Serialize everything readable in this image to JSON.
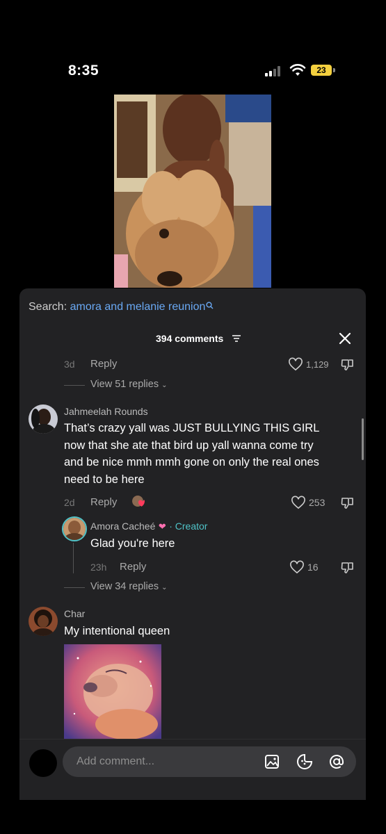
{
  "status_bar": {
    "time": "8:35",
    "battery": "23"
  },
  "sheet": {
    "search_label": "Search: ",
    "search_term": "amora and melanie reunion",
    "comments_count": "394 comments"
  },
  "top_thread": {
    "age": "3d",
    "reply_label": "Reply",
    "likes": "1,129",
    "view_replies": "View 51 replies"
  },
  "comments": [
    {
      "username": "Jahmeelah Rounds",
      "text_lines": [
        "That’s crazy yall was JUST BULLYING THIS GIRL",
        "now that she ate that bird up yall wanna come try",
        "and be nice mmh mmh gone on only the real ones",
        "need to be here"
      ],
      "age": "2d",
      "reply_label": "Reply",
      "likes": "253"
    },
    {
      "username": "Char",
      "text": "My intentional queen"
    }
  ],
  "creator_reply": {
    "username": "Amora Cacheé",
    "creator_label": "· Creator",
    "text": "Glad you're here",
    "age": "23h",
    "reply_label": "Reply",
    "likes": "16",
    "view_replies": "View 34 replies"
  },
  "composer": {
    "placeholder": "Add comment..."
  },
  "colors": {
    "accent_link": "#6aa9f4",
    "creator_teal": "#4fc3c8",
    "battery": "#f4d03f"
  }
}
